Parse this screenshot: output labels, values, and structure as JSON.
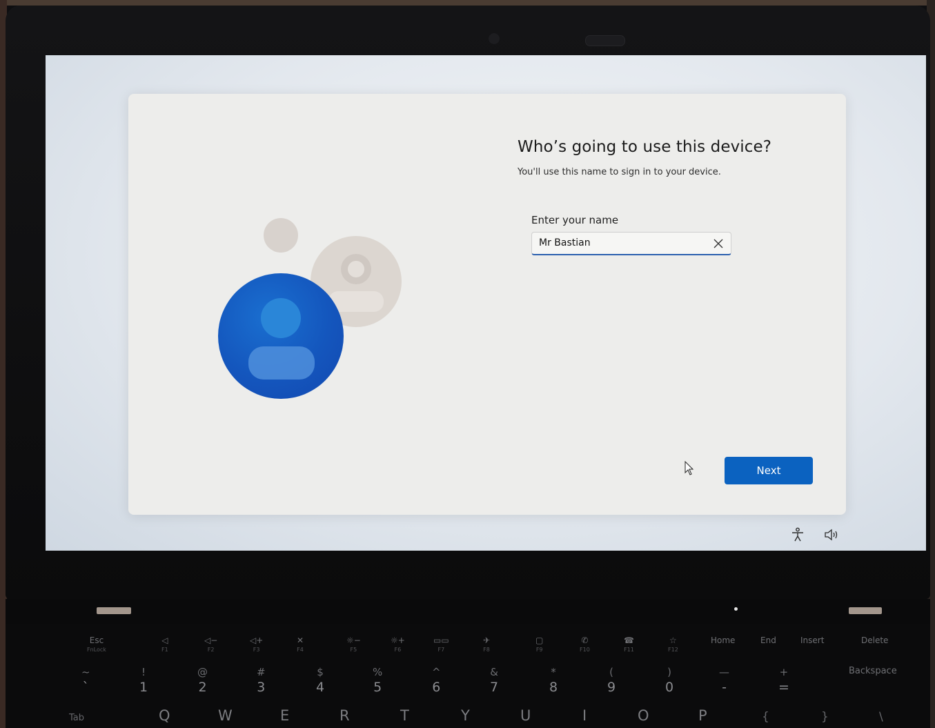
{
  "setup": {
    "title": "Who’s going to use this device?",
    "subtitle": "You'll use this name to sign in to your device.",
    "name_label": "Enter your name",
    "name_value": "Mr Bastian",
    "next_label": "Next"
  },
  "icons": {
    "clear": "close-icon",
    "accessibility": "accessibility-icon",
    "volume": "volume-icon",
    "cursor": "mouse-pointer-icon"
  },
  "colors": {
    "accent": "#0b62c0",
    "avatar_primary": "#1456bd",
    "avatar_secondary": "#dcd6d0"
  },
  "keyboard": {
    "fkeys": [
      {
        "top": "Esc",
        "sub": "FnLock"
      },
      {
        "top": "◁",
        "sub": "F1"
      },
      {
        "top": "◁−",
        "sub": "F2"
      },
      {
        "top": "◁+",
        "sub": "F3"
      },
      {
        "top": "✕",
        "sub": "F4"
      },
      {
        "top": "☼−",
        "sub": "F5"
      },
      {
        "top": "☼+",
        "sub": "F6"
      },
      {
        "top": "▭▭",
        "sub": "F7"
      },
      {
        "top": "✈",
        "sub": "F8"
      },
      {
        "top": "▢",
        "sub": "F9"
      },
      {
        "top": "✆",
        "sub": "F10"
      },
      {
        "top": "☎",
        "sub": "F11"
      },
      {
        "top": "☆",
        "sub": "F12"
      },
      {
        "top": "Home",
        "sub": ""
      },
      {
        "top": "End",
        "sub": ""
      },
      {
        "top": "Insert",
        "sub": ""
      },
      {
        "top": "Delete",
        "sub": ""
      }
    ],
    "numbers": [
      {
        "top": "~",
        "bot": "`"
      },
      {
        "top": "!",
        "bot": "1"
      },
      {
        "top": "@",
        "bot": "2"
      },
      {
        "top": "#",
        "bot": "3"
      },
      {
        "top": "$",
        "bot": "4"
      },
      {
        "top": "%",
        "bot": "5"
      },
      {
        "top": "^",
        "bot": "6"
      },
      {
        "top": "&",
        "bot": "7"
      },
      {
        "top": "*",
        "bot": "8"
      },
      {
        "top": "(",
        "bot": "9"
      },
      {
        "top": ")",
        "bot": "0"
      },
      {
        "top": "—",
        "bot": "-"
      },
      {
        "top": "+",
        "bot": "="
      }
    ],
    "backspace": "Backspace",
    "letters": [
      "Tab",
      "Q",
      "W",
      "E",
      "R",
      "T",
      "Y",
      "U",
      "I",
      "O",
      "P",
      "{",
      "}",
      "\\"
    ]
  }
}
